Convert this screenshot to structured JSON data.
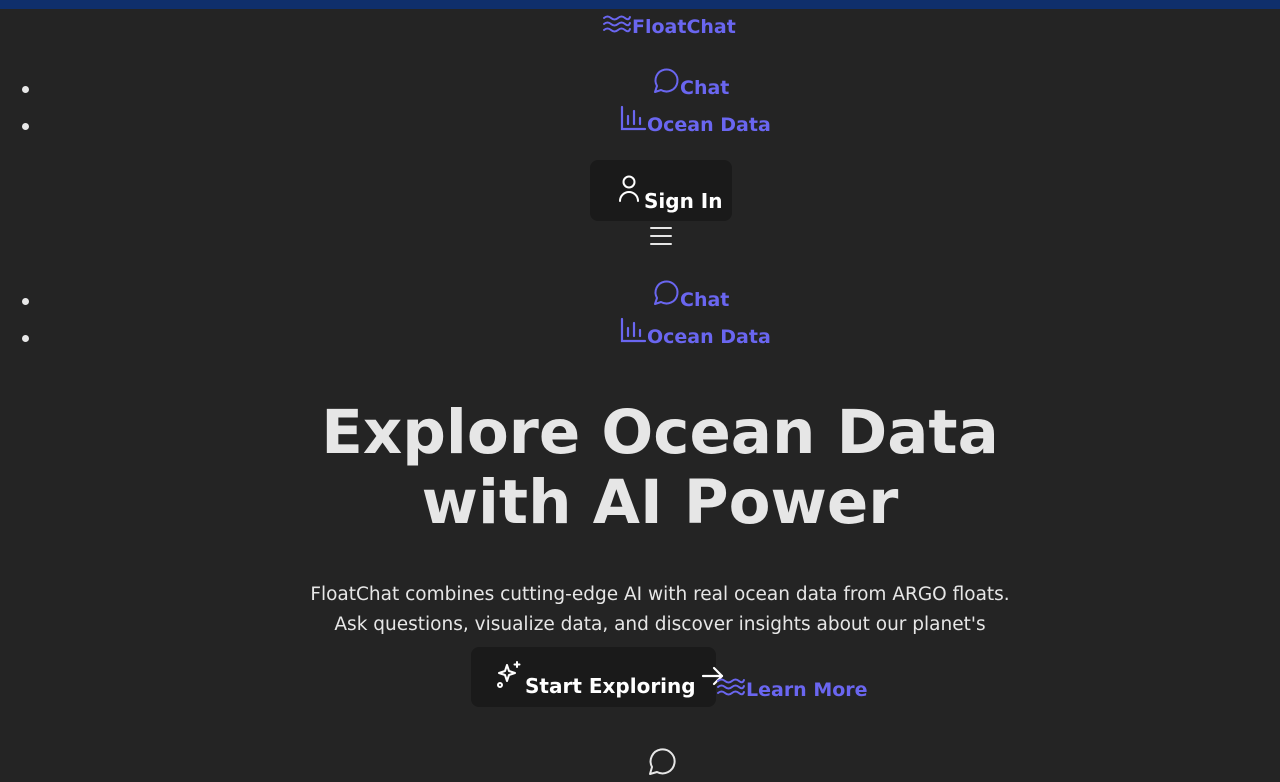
{
  "brand": {
    "name": "FloatChat",
    "icon": "waves-icon"
  },
  "nav": {
    "items": [
      {
        "label": "Chat",
        "icon": "message-circle-icon"
      },
      {
        "label": "Ocean Data",
        "icon": "bar-chart-icon"
      }
    ]
  },
  "auth": {
    "signin_label": "Sign In",
    "icon": "user-icon"
  },
  "mobile_menu": {
    "icon": "menu-icon",
    "items": [
      {
        "label": "Chat",
        "icon": "message-circle-icon"
      },
      {
        "label": "Ocean Data",
        "icon": "bar-chart-icon"
      }
    ]
  },
  "hero": {
    "title_line1": "Explore Ocean Data",
    "title_line2": "with AI Power",
    "subtitle_line1": "FloatChat combines cutting-edge AI with real ocean data from ARGO floats.",
    "subtitle_line2": "Ask questions, visualize data, and discover insights about our planet's oceans.",
    "primary_cta": "Start Exploring",
    "secondary_cta": "Learn More"
  },
  "colors": {
    "background": "#242424",
    "topbar": "#0f2f6b",
    "accent": "#6a66f0",
    "button_bg": "#1a1a1a",
    "text": "#e6e6e6"
  }
}
